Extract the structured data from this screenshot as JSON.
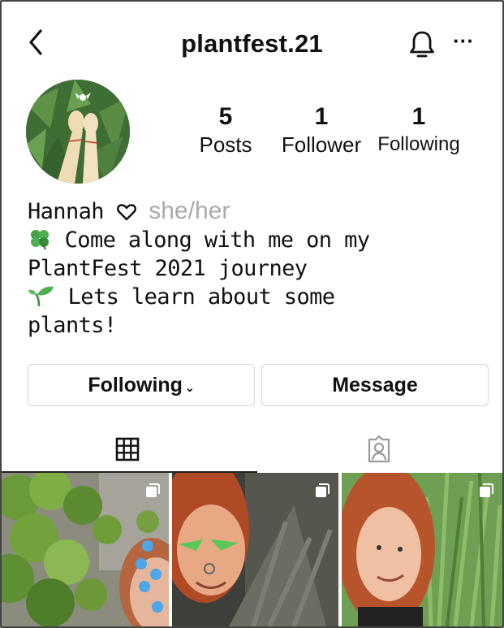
{
  "header": {
    "username": "plantfest.21",
    "back_icon": "chevron-left-icon",
    "bell_icon": "bell-icon",
    "more_icon": "more-horizontal-icon",
    "more_glyph": "···"
  },
  "profile": {
    "stats": [
      {
        "value": "5",
        "label": "Posts"
      },
      {
        "value": "1",
        "label": "Follower"
      },
      {
        "value": "1",
        "label": "Following"
      }
    ],
    "bio": {
      "name": "Hannah",
      "pronouns": "she/her",
      "line1": "Come along with me on my",
      "line2": "PlantFest 2021 journey",
      "line3": "Lets learn about some",
      "line4": "plants!"
    }
  },
  "actions": {
    "following_label": "Following",
    "following_chevron": "⌄",
    "message_label": "Message"
  },
  "tabs": [
    {
      "name": "grid",
      "icon": "grid-icon",
      "active": true
    },
    {
      "name": "tagged",
      "icon": "tagged-person-icon",
      "active": false
    }
  ],
  "colors": {
    "pronoun_gray": "#aaaaaa",
    "button_border": "#d6d6d6",
    "clover_green": "#4caf50"
  }
}
